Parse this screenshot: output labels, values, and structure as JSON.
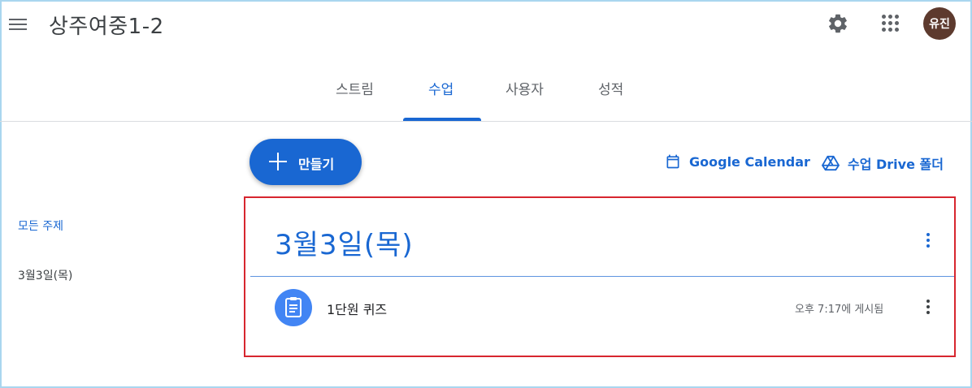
{
  "header": {
    "class_title": "상주여중1-2",
    "avatar_text": "유진"
  },
  "tabs": [
    {
      "label": "스트림"
    },
    {
      "label": "수업"
    },
    {
      "label": "사용자"
    },
    {
      "label": "성적"
    }
  ],
  "active_tab": "수업",
  "toolbar": {
    "create_label": "만들기",
    "calendar_link": "Google Calendar",
    "drive_link": "수업 Drive 폴더"
  },
  "sidebar": {
    "all_topics": "모든 주제",
    "topics": [
      {
        "label": "3월3일(목)"
      }
    ]
  },
  "topic": {
    "title": "3월3일(목)",
    "items": [
      {
        "title": "1단원 퀴즈",
        "posted": "오후 7:17에 게시됨"
      }
    ]
  },
  "colors": {
    "accent": "#1967d2",
    "highlight_border": "#d7262f",
    "avatar_bg": "#5d3a2e",
    "assignment_icon_bg": "#4285f4"
  }
}
